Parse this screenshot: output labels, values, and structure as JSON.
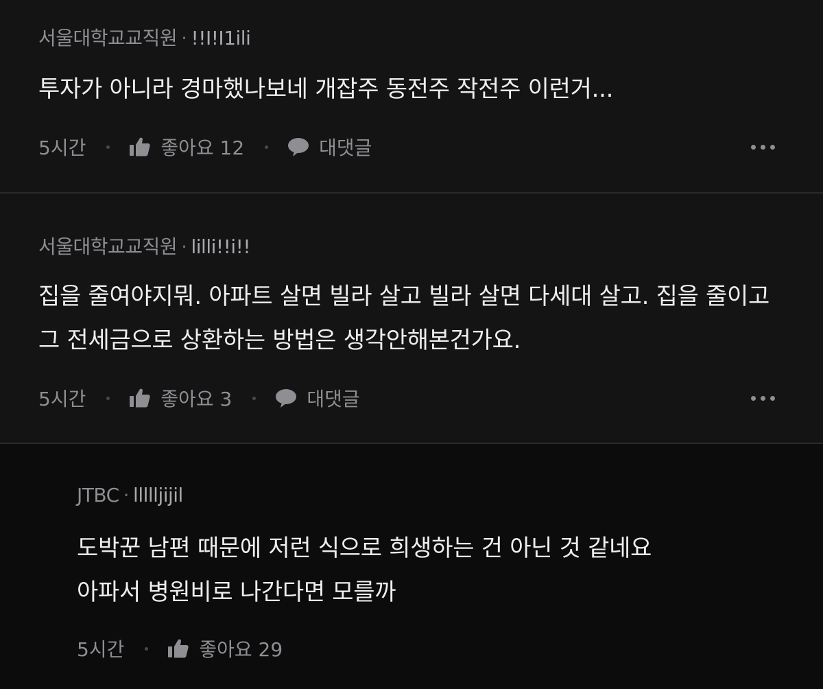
{
  "comments": [
    {
      "author": "서울대학교교직원",
      "nickname": "!!I!I1ili",
      "body": "투자가 아니라 경마했나보네 개잡주 동전주 작전주 이런거...",
      "time": "5시간",
      "like_label": "좋아요 12",
      "reply_label": "대댓글"
    },
    {
      "author": "서울대학교교직원",
      "nickname": "lilli!!i!!",
      "body": "집을 줄여야지뭐. 아파트 살면 빌라 살고 빌라 살면 다세대 살고. 집을 줄이고 그 전세금으로 상환하는 방법은 생각안해본건가요.",
      "time": "5시간",
      "like_label": "좋아요 3",
      "reply_label": "대댓글"
    }
  ],
  "reply": {
    "author": "JTBC",
    "nickname": "llllljijil",
    "body_line1": "도박꾼 남편 때문에 저런 식으로 희생하는 건 아닌 것 같네요",
    "body_line2": "아파서 병원비로 나간다면 모를까",
    "time": "5시간",
    "like_label": "좋아요 29"
  },
  "icons": {
    "like": "thumbs-up-icon",
    "reply": "speech-bubble-icon",
    "more": "more-horizontal-icon"
  },
  "colors": {
    "background": "#111112",
    "text": "#eeeeee",
    "muted": "#8e8e93",
    "divider": "#2a2a2c"
  }
}
